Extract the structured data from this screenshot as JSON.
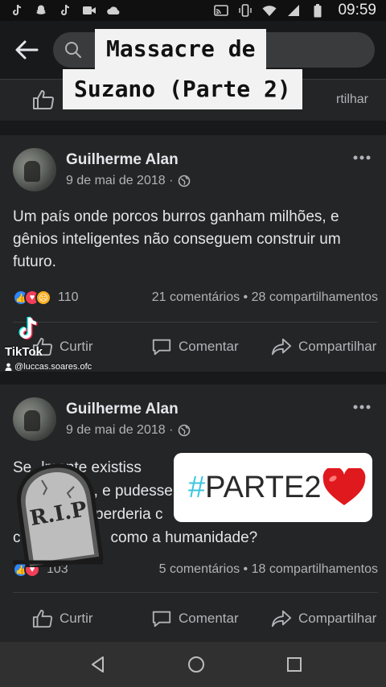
{
  "status_bar": {
    "time": "09:59",
    "left_icons": [
      "tiktok-icon",
      "snapchat-icon",
      "tiktok-icon",
      "video-icon",
      "cloud-icon"
    ],
    "right_icons": [
      "cast-icon",
      "vibrate-icon",
      "wifi-icon",
      "signal-icon",
      "battery-icon"
    ]
  },
  "overlay_title": {
    "line1": "Massacre de",
    "line2": "Suzano (Parte 2)"
  },
  "prev_post": {
    "share_label": "rtilhar"
  },
  "posts": [
    {
      "author": "Guilherme Alan",
      "date": "9 de mai de 2018 ·",
      "text": "Um país onde porcos burros ganham milhões, e gênios inteligentes não conseguem construir um futuro.",
      "reaction_count": "110",
      "stats": "21 comentários • 28 compartilhamentos",
      "like_label": "Curtir",
      "comment_label": "Comentar",
      "share_label": "Compartilhar"
    },
    {
      "author": "Guilherme Alan",
      "date": "9 de mai de 2018 ·",
      "text": "Se realmente existisse ... e, e pudesse ... perderia ... como a humanidade?",
      "text_parts": {
        "l1": "Se",
        "l1b": "lmente existiss",
        "l2": "e, e pudesse",
        "l3": "perderia c",
        "l4a": "c",
        "l4b": "como a humanidade?"
      },
      "reaction_count": "103",
      "stats": "5 comentários • 18 compartilhamentos",
      "like_label": "Curtir",
      "comment_label": "Comentar",
      "share_label": "Compartilhar"
    }
  ],
  "tiktok_watermark": {
    "brand": "TikTok",
    "username": "@luccas.soares.ofc"
  },
  "sticker": {
    "hash": "#",
    "text": "PARTE2"
  },
  "rip_stone": {
    "text": "R.I.P"
  },
  "colors": {
    "background": "#18191a",
    "card": "#242526",
    "accent_like": "#2d88ff",
    "sticker_hash": "#3cc6e0",
    "heart": "#e0191e"
  }
}
